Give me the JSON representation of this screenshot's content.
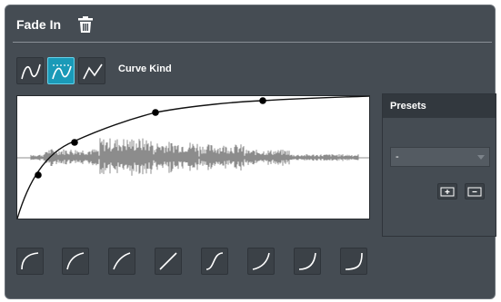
{
  "dialog": {
    "title": "Fade In",
    "trash_icon": "trash-icon"
  },
  "curve_kind": {
    "label": "Curve Kind",
    "buttons": [
      {
        "name": "spline-interpolation",
        "icon": "spline-curve-icon",
        "active": false
      },
      {
        "name": "damped-spline-interpolation",
        "icon": "damped-spline-curve-icon",
        "active": true
      },
      {
        "name": "linear-interpolation",
        "icon": "linear-curve-icon",
        "active": false
      }
    ]
  },
  "presets": {
    "title": "Presets",
    "selected": "-",
    "store_icon": "store-preset-icon",
    "remove_icon": "remove-preset-icon"
  },
  "curve_shapes": [
    {
      "icon": "fade-shape-1-icon"
    },
    {
      "icon": "fade-shape-2-icon"
    },
    {
      "icon": "fade-shape-3-icon"
    },
    {
      "icon": "fade-shape-linear-icon"
    },
    {
      "icon": "fade-shape-s-curve-icon"
    },
    {
      "icon": "fade-shape-6-icon"
    },
    {
      "icon": "fade-shape-7-icon"
    },
    {
      "icon": "fade-shape-8-icon"
    }
  ],
  "colors": {
    "panel": "#454c53",
    "accent": "#1a9ab8",
    "waveform": "#8c8c8c"
  }
}
